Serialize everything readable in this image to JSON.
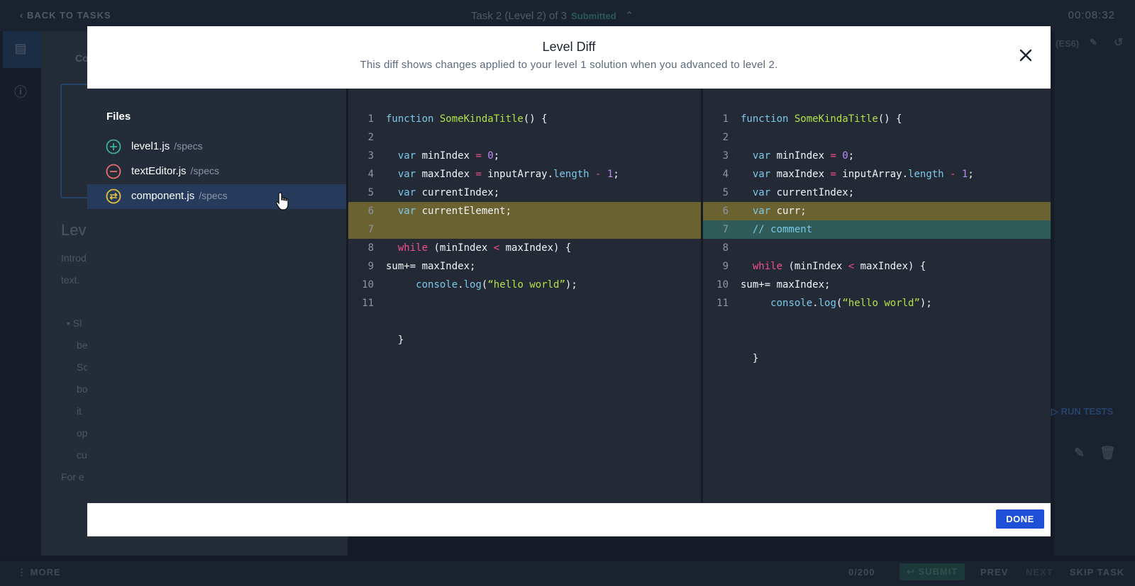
{
  "topbar": {
    "back_label": "BACK TO TASKS",
    "task_title": "Task 2 (Level 2) of 3",
    "task_status": "Submitted",
    "timer": "00:08:32"
  },
  "left_pane": {
    "fragments": [
      "Co",
      "Lev",
      "Introd",
      "text.",
      "• Sl",
      "be",
      "Sc",
      "bo",
      "it",
      "op",
      "cu",
      "For e"
    ]
  },
  "right_pane": {
    "language": "(ES6)",
    "run_tests_label": "RUN TESTS"
  },
  "bottombar": {
    "more_label": "MORE",
    "progress": "0/200",
    "submit_label": "SUBMIT",
    "prev_label": "PREV",
    "next_label": "NEXT",
    "skip_label": "SKIP TASK"
  },
  "modal": {
    "title": "Level Diff",
    "subtitle": "This diff shows changes applied to your level 1 solution when you advanced to level 2.",
    "files_title": "Files",
    "files": [
      {
        "name": "level1.js",
        "path": "/specs",
        "status": "added",
        "icon": "plus-circle-icon",
        "color": "#3bb08f"
      },
      {
        "name": "textEditor.js",
        "path": "/specs",
        "status": "removed",
        "icon": "minus-circle-icon",
        "color": "#e8706f"
      },
      {
        "name": "component.js",
        "path": "/specs",
        "status": "modified",
        "icon": "swap-circle-icon",
        "color": "#e8c13d",
        "selected": true
      }
    ],
    "done_label": "DONE"
  },
  "diff": {
    "left": [
      {
        "n": "1",
        "tokens": [
          [
            "kw",
            "function "
          ],
          [
            "fn",
            "SomeKindaTitle"
          ],
          [
            "",
            "() {"
          ]
        ]
      },
      {
        "n": "2",
        "tokens": []
      },
      {
        "n": "3",
        "tokens": [
          [
            "",
            "  "
          ],
          [
            "kw",
            "var "
          ],
          [
            "",
            "minIndex "
          ],
          [
            "op",
            "="
          ],
          [
            "",
            ""
          ],
          [
            "num",
            " 0"
          ],
          [
            "",
            ";"
          ]
        ]
      },
      {
        "n": "4",
        "tokens": [
          [
            "",
            "  "
          ],
          [
            "kw",
            "var "
          ],
          [
            "",
            "maxIndex "
          ],
          [
            "op",
            "="
          ],
          [
            "",
            ""
          ],
          [
            "",
            " inputArray."
          ],
          [
            "prop",
            "length"
          ],
          [
            "op",
            " -"
          ],
          [
            "num",
            " 1"
          ],
          [
            "",
            ";"
          ]
        ]
      },
      {
        "n": "5",
        "tokens": [
          [
            "",
            "  "
          ],
          [
            "kw",
            "var "
          ],
          [
            "",
            "currentIndex;"
          ]
        ]
      },
      {
        "n": "6",
        "hl": "change",
        "tokens": [
          [
            "",
            "  "
          ],
          [
            "kw",
            "var "
          ],
          [
            "",
            "currentElement;"
          ]
        ]
      },
      {
        "n": "7",
        "hl": "change",
        "tokens": []
      },
      {
        "n": "8",
        "tokens": [
          [
            "",
            "  "
          ],
          [
            "kw2",
            "while "
          ],
          [
            "",
            "(minIndex "
          ],
          [
            "op",
            "<"
          ],
          [
            "",
            " maxIndex) {"
          ]
        ]
      },
      {
        "n": "9",
        "tokens": [
          [
            "",
            "sum+= maxIndex;"
          ]
        ]
      },
      {
        "n": "10",
        "tokens": [
          [
            "",
            "     "
          ],
          [
            "prop",
            "console"
          ],
          [
            "",
            "."
          ],
          [
            "prop",
            "log"
          ],
          [
            "",
            "("
          ],
          [
            "str",
            "“hello world”"
          ],
          [
            "",
            ");"
          ]
        ]
      },
      {
        "n": "11",
        "tokens": []
      },
      {
        "n": "",
        "tokens": []
      },
      {
        "n": "",
        "tokens": [
          [
            "",
            "  }"
          ]
        ]
      }
    ],
    "right": [
      {
        "n": "1",
        "tokens": [
          [
            "kw",
            "function "
          ],
          [
            "fn",
            "SomeKindaTitle"
          ],
          [
            "",
            "() {"
          ]
        ]
      },
      {
        "n": "2",
        "tokens": []
      },
      {
        "n": "3",
        "tokens": [
          [
            "",
            "  "
          ],
          [
            "kw",
            "var "
          ],
          [
            "",
            "minIndex "
          ],
          [
            "op",
            "="
          ],
          [
            "num",
            " 0"
          ],
          [
            "",
            ";"
          ]
        ]
      },
      {
        "n": "4",
        "tokens": [
          [
            "",
            "  "
          ],
          [
            "kw",
            "var "
          ],
          [
            "",
            "maxIndex "
          ],
          [
            "op",
            "="
          ],
          [
            "",
            " inputArray."
          ],
          [
            "prop",
            "length"
          ],
          [
            "op",
            " -"
          ],
          [
            "num",
            " 1"
          ],
          [
            "",
            ";"
          ]
        ]
      },
      {
        "n": "5",
        "tokens": [
          [
            "",
            "  "
          ],
          [
            "kw",
            "var "
          ],
          [
            "",
            "currentIndex;"
          ]
        ]
      },
      {
        "n": "6",
        "hl": "change",
        "tokens": [
          [
            "",
            "  "
          ],
          [
            "kw",
            "var "
          ],
          [
            "",
            "curr;"
          ]
        ]
      },
      {
        "n": "7",
        "hl": "add",
        "tokens": [
          [
            "",
            "  "
          ],
          [
            "cm",
            "// comment"
          ]
        ]
      },
      {
        "n": "8",
        "tokens": []
      },
      {
        "n": "9",
        "tokens": [
          [
            "",
            "  "
          ],
          [
            "kw2",
            "while "
          ],
          [
            "",
            "(minIndex "
          ],
          [
            "op",
            "<"
          ],
          [
            "",
            " maxIndex) {"
          ]
        ]
      },
      {
        "n": "10",
        "tokens": [
          [
            "",
            "sum+= maxIndex;"
          ]
        ]
      },
      {
        "n": "11",
        "tokens": [
          [
            "",
            "     "
          ],
          [
            "prop",
            "console"
          ],
          [
            "",
            "."
          ],
          [
            "prop",
            "log"
          ],
          [
            "",
            "("
          ],
          [
            "str",
            "“hello world”"
          ],
          [
            "",
            ");"
          ]
        ]
      },
      {
        "n": "",
        "tokens": []
      },
      {
        "n": "",
        "tokens": []
      },
      {
        "n": "",
        "tokens": [
          [
            "",
            "  }"
          ]
        ]
      }
    ]
  }
}
